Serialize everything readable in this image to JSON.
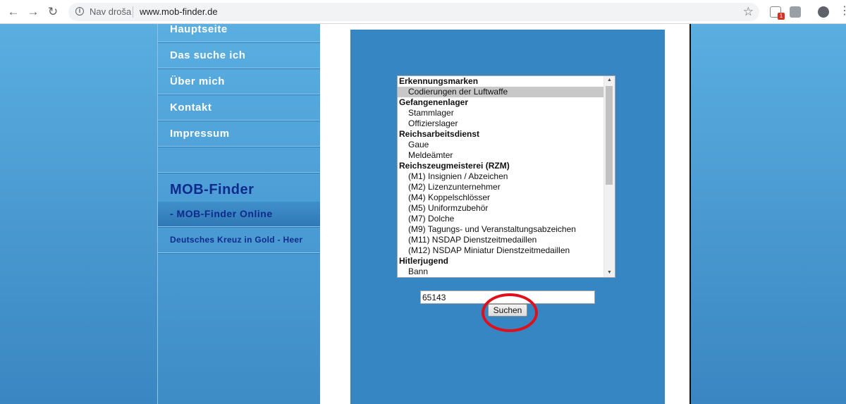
{
  "browser": {
    "not_secure_label": "Nav droša",
    "url": "www.mob-finder.de",
    "extension_badge": "1",
    "back_icon": "←",
    "forward_icon": "→",
    "reload_icon": "↻",
    "star_icon": "☆",
    "menu_icon": "⋮"
  },
  "sidebar": {
    "items": [
      {
        "label": "Hauptseite"
      },
      {
        "label": "Das suche ich"
      },
      {
        "label": "Über mich"
      },
      {
        "label": "Kontakt"
      },
      {
        "label": "Impressum"
      }
    ],
    "section_title": "MOB-Finder",
    "online_link": "- MOB-Finder Online",
    "kreuz_link": "Deutsches Kreuz in Gold - Heer"
  },
  "main": {
    "options": [
      {
        "label": "Erkennungsmarken",
        "type": "group"
      },
      {
        "label": "Codierungen der Luftwaffe",
        "type": "child",
        "selected": true
      },
      {
        "label": "Gefangenenlager",
        "type": "group"
      },
      {
        "label": "Stammlager",
        "type": "child"
      },
      {
        "label": "Offizierslager",
        "type": "child"
      },
      {
        "label": "Reichsarbeitsdienst",
        "type": "group"
      },
      {
        "label": "Gaue",
        "type": "child"
      },
      {
        "label": "Meldeämter",
        "type": "child"
      },
      {
        "label": "Reichszeugmeisterei (RZM)",
        "type": "group"
      },
      {
        "label": "(M1) Insignien / Abzeichen",
        "type": "child"
      },
      {
        "label": "(M2) Lizenzunternehmer",
        "type": "child"
      },
      {
        "label": "(M4) Koppelschlösser",
        "type": "child"
      },
      {
        "label": "(M5) Uniformzubehör",
        "type": "child"
      },
      {
        "label": "(M7) Dolche",
        "type": "child"
      },
      {
        "label": "(M9) Tagungs- und Veranstaltungsabzeichen",
        "type": "child"
      },
      {
        "label": "(M11) NSDAP Dienstzeitmedaillen",
        "type": "child"
      },
      {
        "label": "(M12) NSDAP Miniatur Dienstzeitmedaillen",
        "type": "child"
      },
      {
        "label": "Hitlerjugend",
        "type": "group"
      },
      {
        "label": "Bann",
        "type": "child"
      }
    ],
    "search_value": "65143",
    "search_button": "Suchen"
  },
  "colors": {
    "accent": "#3586c3",
    "sidebar_link_dark": "#0e2a8c",
    "highlight_circle": "#e0101a"
  }
}
